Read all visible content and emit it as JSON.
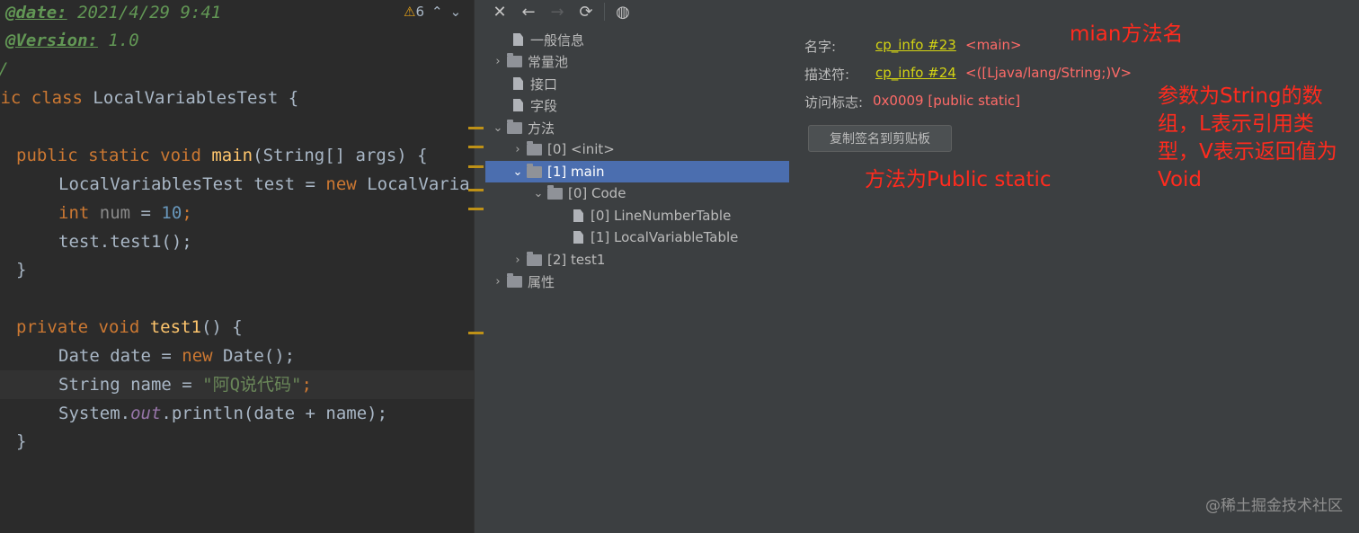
{
  "editor": {
    "lines": {
      "l1_tag": "@date:",
      "l1_val": " 2021/4/29 9:41",
      "l2_tag": "@Version:",
      "l2_val": " 1.0",
      "l3": "/",
      "l4_kw": "lic class",
      "l4_rest": " LocalVariablesTest {",
      "l6_kw": "public static void",
      "l6_fn": "main",
      "l6_rest": "(String[] args) {",
      "l7_a": "LocalVariablesTest test = ",
      "l7_kw": "new",
      "l7_b": " LocalVaria",
      "l8_kw": "int",
      "l8_var": " num",
      "l8_eq": " = ",
      "l8_num": "10",
      "l8_semi": ";",
      "l9": "test.test1();",
      "l10": "}",
      "l12_kw": "private void",
      "l12_fn": "test1",
      "l12_rest": "() {",
      "l13_a": "Date date = ",
      "l13_kw": "new",
      "l13_b": " Date();",
      "l14_a": "String name = ",
      "l14_str": "\"阿Q说代码\"",
      "l14_semi": ";",
      "l15_a": "System.",
      "l15_out": "out",
      "l15_b": ".println(date + name);",
      "l16": "}"
    },
    "warning_count": "6"
  },
  "toolbar": {
    "icons": [
      "close-icon",
      "back-icon",
      "forward-icon",
      "refresh-icon",
      "globe-icon"
    ]
  },
  "tree": {
    "general": "一般信息",
    "constant_pool": "常量池",
    "interfaces": "接口",
    "fields": "字段",
    "methods": "方法",
    "init": "[0] <init>",
    "main": "[1] main",
    "code": "[0] Code",
    "line_number_table": "[0] LineNumberTable",
    "local_variable_table": "[1] LocalVariableTable",
    "test1": "[2] test1",
    "attributes": "属性"
  },
  "details": {
    "name_label": "名字:",
    "name_link": "cp_info #23",
    "name_value": "<main>",
    "desc_label": "描述符:",
    "desc_link": "cp_info #24",
    "desc_value": "<([Ljava/lang/String;)V>",
    "access_label": "访问标志:",
    "access_value": "0x0009 [public static]",
    "copy_button": "复制签名到剪贴板"
  },
  "annotations": {
    "method_name": "mian方法名",
    "access": "方法为Public static",
    "params": [
      "参数为String的数",
      "组，L表示引用类",
      "型，V表示返回值为",
      "Void"
    ]
  },
  "watermark": "@稀土掘金技术社区",
  "colors": {
    "annotation": "#ff2b1e",
    "selection": "#4b6eaf",
    "link": "#d4d413",
    "value": "#ff6b68"
  }
}
